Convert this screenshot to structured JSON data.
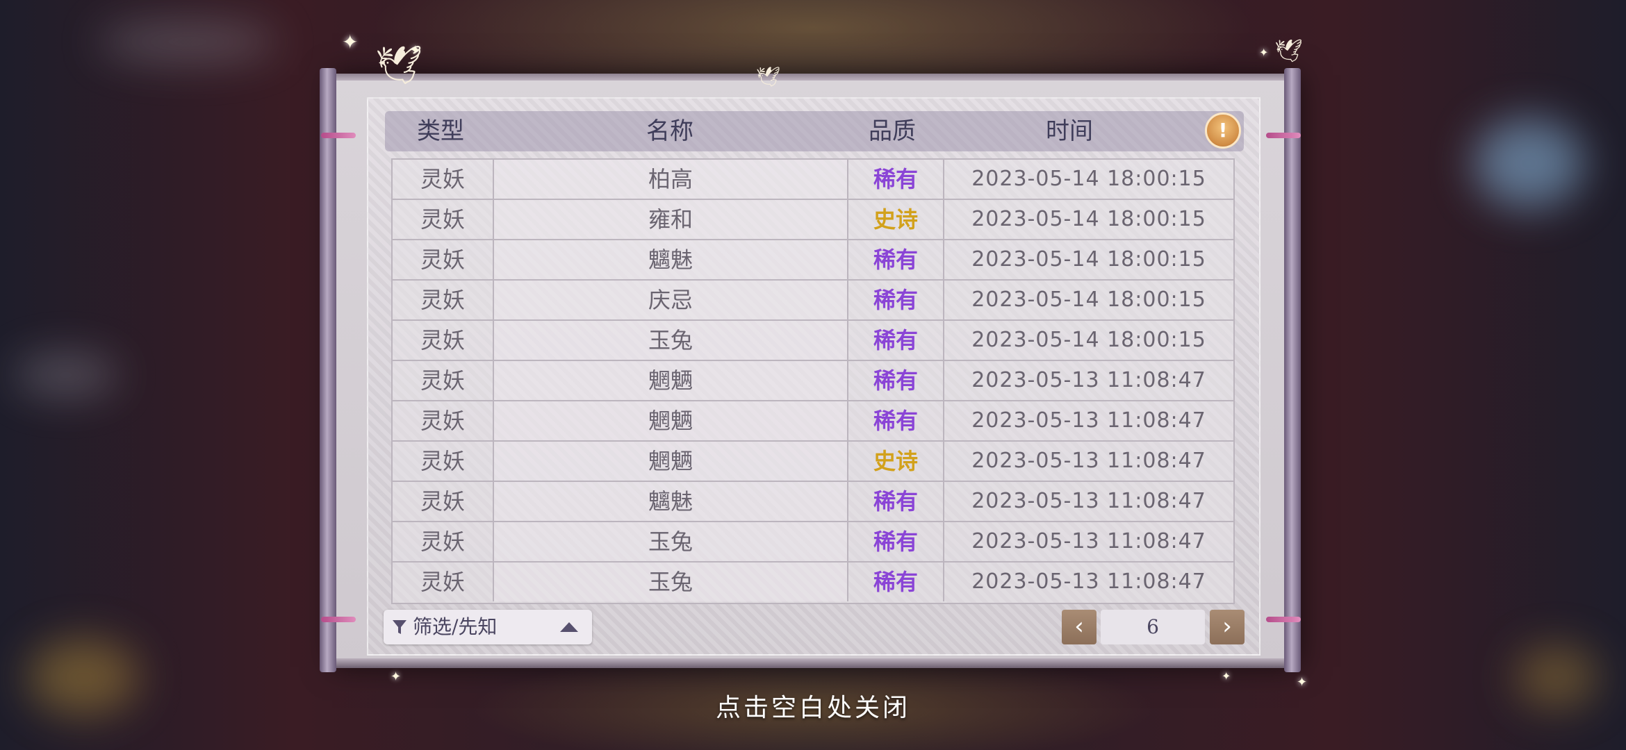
{
  "header": {
    "type": "类型",
    "name": "名称",
    "quality": "品质",
    "time": "时间"
  },
  "colors": {
    "rare": "#8a44d6",
    "epic": "#d2a11b"
  },
  "rows": [
    {
      "type": "灵妖",
      "name": "柏高",
      "quality": "稀有",
      "tier": "rare",
      "time": "2023-05-14  18:00:15"
    },
    {
      "type": "灵妖",
      "name": "雍和",
      "quality": "史诗",
      "tier": "epic",
      "time": "2023-05-14  18:00:15"
    },
    {
      "type": "灵妖",
      "name": "魑魅",
      "quality": "稀有",
      "tier": "rare",
      "time": "2023-05-14  18:00:15"
    },
    {
      "type": "灵妖",
      "name": "庆忌",
      "quality": "稀有",
      "tier": "rare",
      "time": "2023-05-14  18:00:15"
    },
    {
      "type": "灵妖",
      "name": "玉兔",
      "quality": "稀有",
      "tier": "rare",
      "time": "2023-05-14  18:00:15"
    },
    {
      "type": "灵妖",
      "name": "魍魉",
      "quality": "稀有",
      "tier": "rare",
      "time": "2023-05-13  11:08:47"
    },
    {
      "type": "灵妖",
      "name": "魍魉",
      "quality": "稀有",
      "tier": "rare",
      "time": "2023-05-13  11:08:47"
    },
    {
      "type": "灵妖",
      "name": "魍魉",
      "quality": "史诗",
      "tier": "epic",
      "time": "2023-05-13  11:08:47"
    },
    {
      "type": "灵妖",
      "name": "魑魅",
      "quality": "稀有",
      "tier": "rare",
      "time": "2023-05-13  11:08:47"
    },
    {
      "type": "灵妖",
      "name": "玉兔",
      "quality": "稀有",
      "tier": "rare",
      "time": "2023-05-13  11:08:47"
    },
    {
      "type": "灵妖",
      "name": "玉兔",
      "quality": "稀有",
      "tier": "rare",
      "time": "2023-05-13  11:08:47"
    }
  ],
  "filter": {
    "label": "筛选/先知",
    "icon": "filter-icon"
  },
  "pagination": {
    "prev_icon": "‹",
    "page": "6",
    "next_icon": "›"
  },
  "close_hint": "点击空白处关闭"
}
